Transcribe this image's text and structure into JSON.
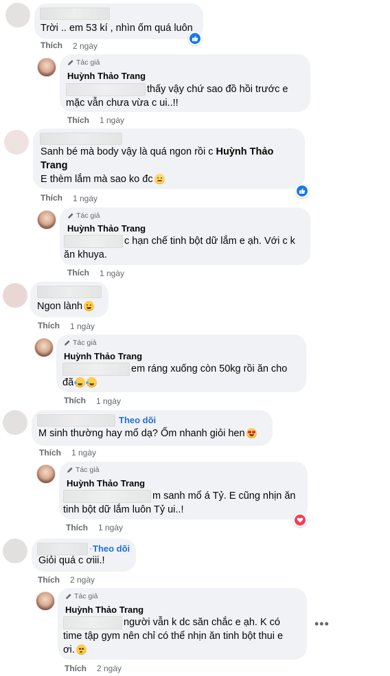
{
  "common": {
    "like_label": "Thích",
    "author_badge": "Tác giả",
    "author_name": "Huỳnh Thảo Trang",
    "follow_label": "Theo dõi",
    "follow_dot": "·",
    "more_dots": "•••"
  },
  "comments": [
    {
      "text": "Trời .. em 53 kí , nhìn ốm quá luôn",
      "time": "2 ngày",
      "reaction": "like",
      "reply": {
        "line1": "thấy vậy chứ sao đồ hồi trước e",
        "line2": "mặc vẫn chưa vừa c ui..!!",
        "time": "1 ngày"
      }
    },
    {
      "text_line1_prefix": "Sanh bé mà body vậy là quá ngon rồi c ",
      "text_line1_tag": "Huỳnh Thảo",
      "text_line2_tag": "Trang",
      "text_line3": "E thèm lắm mà sao ko đc",
      "time": "1 ngày",
      "reaction": "like",
      "reply": {
        "line1": "c hạn chế tinh bột dữ lắm e ạh. Với c k",
        "line2": "ăn khuya.",
        "time": "1 ngày"
      }
    },
    {
      "text": "Ngon lành",
      "time": "1 ngày",
      "reply": {
        "line1": "em ráng xuống còn 50kg rồi ăn cho",
        "line2": "đã",
        "time": "1 ngày"
      }
    },
    {
      "text": "M sinh thường hay mổ dạ? Ốm nhanh giỏi hen",
      "time": "1 ngày",
      "follow": true,
      "reply": {
        "line1": "m sanh mổ á Tỷ. E cũng nhịn ăn",
        "line2": "tinh bột dữ lắm luôn Tỷ ui..!",
        "time": "1 ngày",
        "reaction": "love"
      }
    },
    {
      "text": "Giỏi quá c ơiii.!",
      "time": "2 ngày",
      "follow": true,
      "reply": {
        "line1": "người vẫn k dc săn chắc e ạh. K có",
        "line2": "time tập gym nên chỉ có thể nhịn ăn tinh bột thui e",
        "line3": "ơi.",
        "time": "2 ngày"
      }
    }
  ],
  "colors": {
    "bubble": "#f0f2f5",
    "link_blue": "#216fdb",
    "meta_gray": "#65676b",
    "like_blue": "#1877f2",
    "love_red": "#f33e58"
  }
}
